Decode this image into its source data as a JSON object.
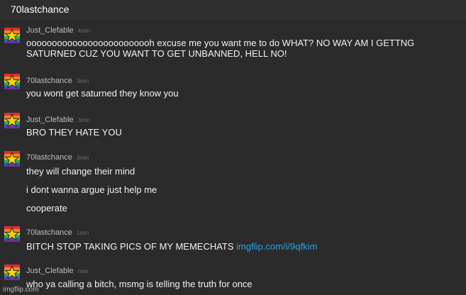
{
  "window": {
    "title": "70lastchance"
  },
  "messages": [
    {
      "user": "Just_Clefable",
      "time": "4min",
      "lines": [
        "ooooooooooooooooooooooooh excuse me you want me to do WHAT? NO WAY AM I GETTNG SATURNED CUZ YOU WANT TO GET UNBANNED, HELL NO!"
      ]
    },
    {
      "user": "70lastchance",
      "time": "3min",
      "lines": [
        "you wont get saturned they know you"
      ]
    },
    {
      "user": "Just_Clefable",
      "time": "3min",
      "lines": [
        "BRO THEY HATE YOU"
      ]
    },
    {
      "user": "70lastchance",
      "time": "3min",
      "lines": [
        "they will change their mind",
        "i dont wanna argue just help me",
        "cooperate"
      ]
    },
    {
      "user": "70lastchance",
      "time": "1min",
      "text": "BITCH STOP TAKING PICS OF MY MEMECHATS ",
      "link": "imgflip.com/i/9qfkim"
    },
    {
      "user": "Just_Clefable",
      "time": "now",
      "lines": [
        "who ya calling a bitch, msmg is telling the truth for once"
      ]
    }
  ],
  "watermark": "imgflip.com",
  "avatar_icon": "rainbow-star-icon"
}
